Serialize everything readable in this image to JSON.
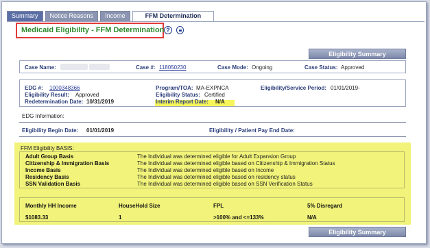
{
  "tabs": [
    {
      "label": "Summary"
    },
    {
      "label": "Notice Reasons"
    },
    {
      "label": "Income"
    },
    {
      "label": "FFM Determination"
    }
  ],
  "page": {
    "title": "Medicaid Eligibility - FFM Determination",
    "help_icon": "help-icon",
    "print_icon": "print-icon"
  },
  "eligibility_summary_button": "Eligibility Summary",
  "case": {
    "name_label": "Case Name:",
    "number_label": "Case #:",
    "number": "118050230",
    "mode_label": "Case Mode:",
    "mode": "Ongoing",
    "status_label": "Case Status:",
    "status": "Approved"
  },
  "edg": {
    "edg_label": "EDG #:",
    "edg_number": "1000348366",
    "result_label": "Eligibility Result:",
    "result": "Approved",
    "redet_label": "Redetermination Date:",
    "redet": "10/31/2019",
    "program_label": "Program/TOA:",
    "program": "MA-EXPNCA",
    "status_label": "Eligibility Status:",
    "status": "Certified",
    "interim_label": "Interim Report Date:",
    "interim": "N/A",
    "period_label": "Eligibility/Service Period:",
    "period": "01/01/2019-"
  },
  "edg_information_label": "EDG Information:",
  "begin_label": "Eligibility Begin Date:",
  "begin_date": "01/01/2019",
  "end_label": "Eligibility / Patient Pay End Date:",
  "ffm": {
    "heading": "FFM Eligibility BASIS:",
    "rows": [
      {
        "basis": "Adult Group Basis",
        "text": "The Individual was determined eligible for Adult Expansion Group"
      },
      {
        "basis": "Citizenship & Immigration Basis",
        "text": "The Individual was determined eligible based on Citizenship & Immigration Status"
      },
      {
        "basis": "Income Basis",
        "text": "The Individual was determined eligible based on Income"
      },
      {
        "basis": "Residency Basis",
        "text": "The Individual was determined eligible based on residency status"
      },
      {
        "basis": "SSN Validation Basis",
        "text": "The Individual was determined eligible based on SSN Verification Status"
      }
    ]
  },
  "income": {
    "headers": [
      "Monthly HH Income",
      "HouseHold Size",
      "FPL",
      "5% Disregard"
    ],
    "values": [
      "$1083.33",
      "1",
      ">100% and <=133%",
      "N/A"
    ]
  },
  "colors": {
    "highlight": "#f1f37a",
    "title_green": "#2e8b2e",
    "label_blue": "#2a3d7a",
    "title_box_red": "#e23b3b"
  }
}
